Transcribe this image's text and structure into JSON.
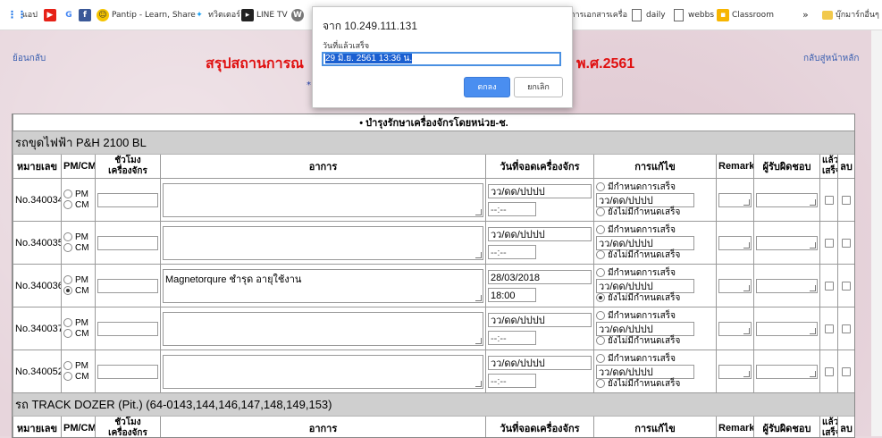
{
  "bookmarks": {
    "apps_label": "แอป",
    "pantip_label": "Pantip - Learn, Share",
    "twitter_label": "ทวิตเตอร์",
    "linetv_label": "LINE TV",
    "doc_label": "การเอกสารเครื่อ",
    "daily_label": "daily",
    "webbs_label": "webbs",
    "classroom_label": "Classroom",
    "more_label": "»",
    "other_label": "บุ๊กมาร์กอื่นๆ"
  },
  "page": {
    "back_link": "ย้อนกลับ",
    "home_link": "กลับสู่หน้าหลัก",
    "title_start": "สรุปสถานการณ",
    "title_end": "พ.ศ.2561",
    "star": "*"
  },
  "dialog": {
    "title": "จาก 10.249.111.131",
    "message": "วันที่แล้วเสร็จ",
    "input_value": "29 มิ.ย. 2561 13:36 น.",
    "ok_label": "ตกลง",
    "cancel_label": "ยกเลิก"
  },
  "table": {
    "bullet_text": "•   บำรุงรักษาเครื่องจักรโดยหน่วย-ช.",
    "headers": {
      "id": "หมายเลข",
      "pmcm": "PM/CM",
      "hours": "ชั่วโมงเครื่องจักร",
      "symptom": "อาการ",
      "park_date": "วันที่จอดเครื่องจักร",
      "fix": "การแก้ไข",
      "remark": "Remark",
      "owner": "ผู้รับผิดชอบ",
      "done": "แล้วเสร็จ",
      "delete": "ลบ"
    },
    "options": {
      "pm": "PM",
      "cm": "CM",
      "date_placeholder": "วว/ดด/ปปปป",
      "time_placeholder": "--:--",
      "fix_set": "มีกำหนดการเสร็จ",
      "fix_unset": "ยังไม่มีกำหนดเสร็จ"
    },
    "section1": "รถขุดไฟฟ้า P&H 2100 BL",
    "section2": "รถ TRACK DOZER (Pit.) (64-0143,144,146,147,148,149,153)",
    "rows": [
      {
        "id": "No.340034",
        "symptom": "",
        "date": "",
        "time": ""
      },
      {
        "id": "No.340035",
        "symptom": "",
        "date": "",
        "time": ""
      },
      {
        "id": "No.340036",
        "symptom": "Magnetorqure  ชำรุด อายุใช้งาน",
        "date": "28/03/2018",
        "time": "18:00"
      },
      {
        "id": "No.340037",
        "symptom": "",
        "date": "",
        "time": ""
      },
      {
        "id": "No.340052",
        "symptom": "",
        "date": "",
        "time": ""
      }
    ]
  }
}
